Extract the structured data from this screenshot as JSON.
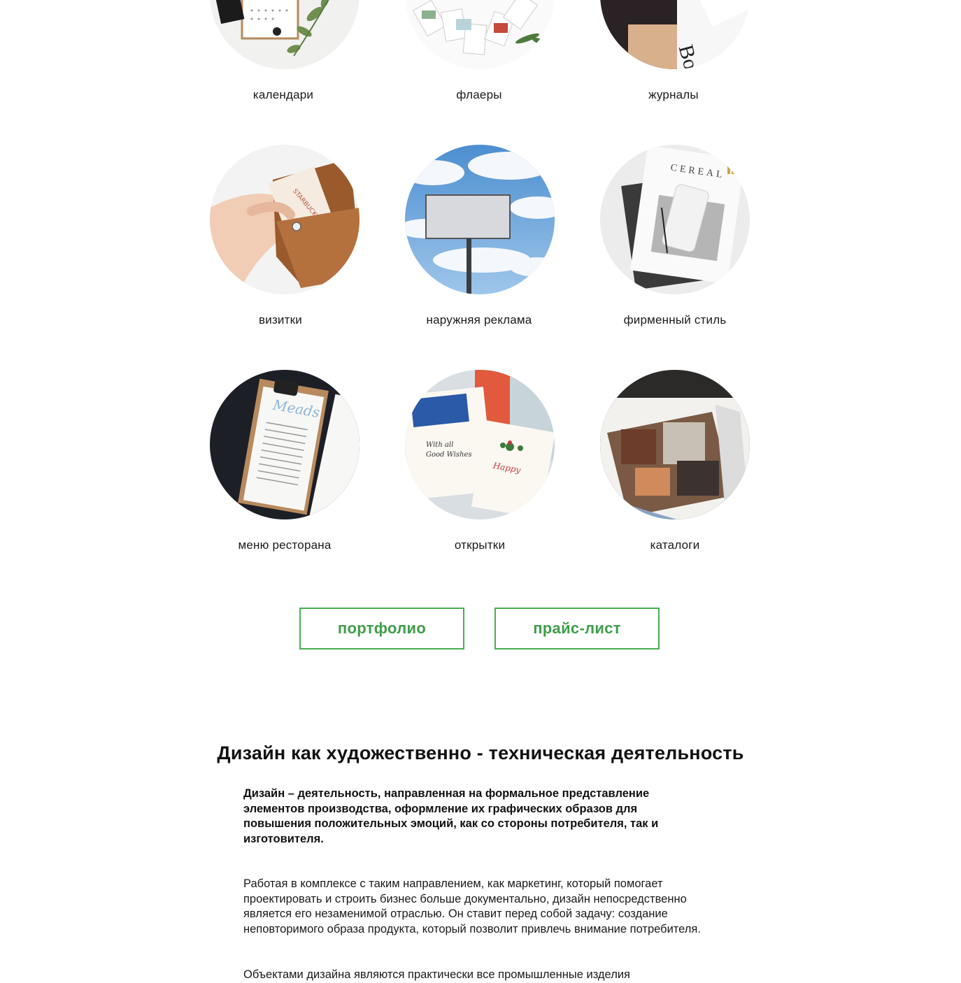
{
  "categories": [
    {
      "label": "календари"
    },
    {
      "label": "флаеры"
    },
    {
      "label": "журналы"
    },
    {
      "label": "визитки"
    },
    {
      "label": "наружняя реклама"
    },
    {
      "label": "фирменный стиль"
    },
    {
      "label": "меню ресторана"
    },
    {
      "label": "открытки"
    },
    {
      "label": "каталоги"
    }
  ],
  "buttons": {
    "portfolio": "портфолио",
    "pricelist": "прайс-лист"
  },
  "article": {
    "heading": "Дизайн как художественно - техническая деятельность",
    "lead": "Дизайн – деятельность, направленная на формальное представление элементов производства, оформление их графических образов для повышения положительных эмоций, как со стороны потребителя, так и изготовителя.",
    "paragraph1": "Работая в комплексе с таким направлением, как маркетинг, который помогает проектировать и строить бизнес больше документально, дизайн непосредственно является его незаменимой отраслью. Он ставит перед собой задачу: создание неповторимого образа продукта, который позволит привлечь внимание потребителя.",
    "paragraph2": "Объектами дизайна являются практически все промышленные изделия"
  },
  "colors": {
    "accent": "#4aad52",
    "text": "#111111",
    "background": "#ffffff"
  }
}
